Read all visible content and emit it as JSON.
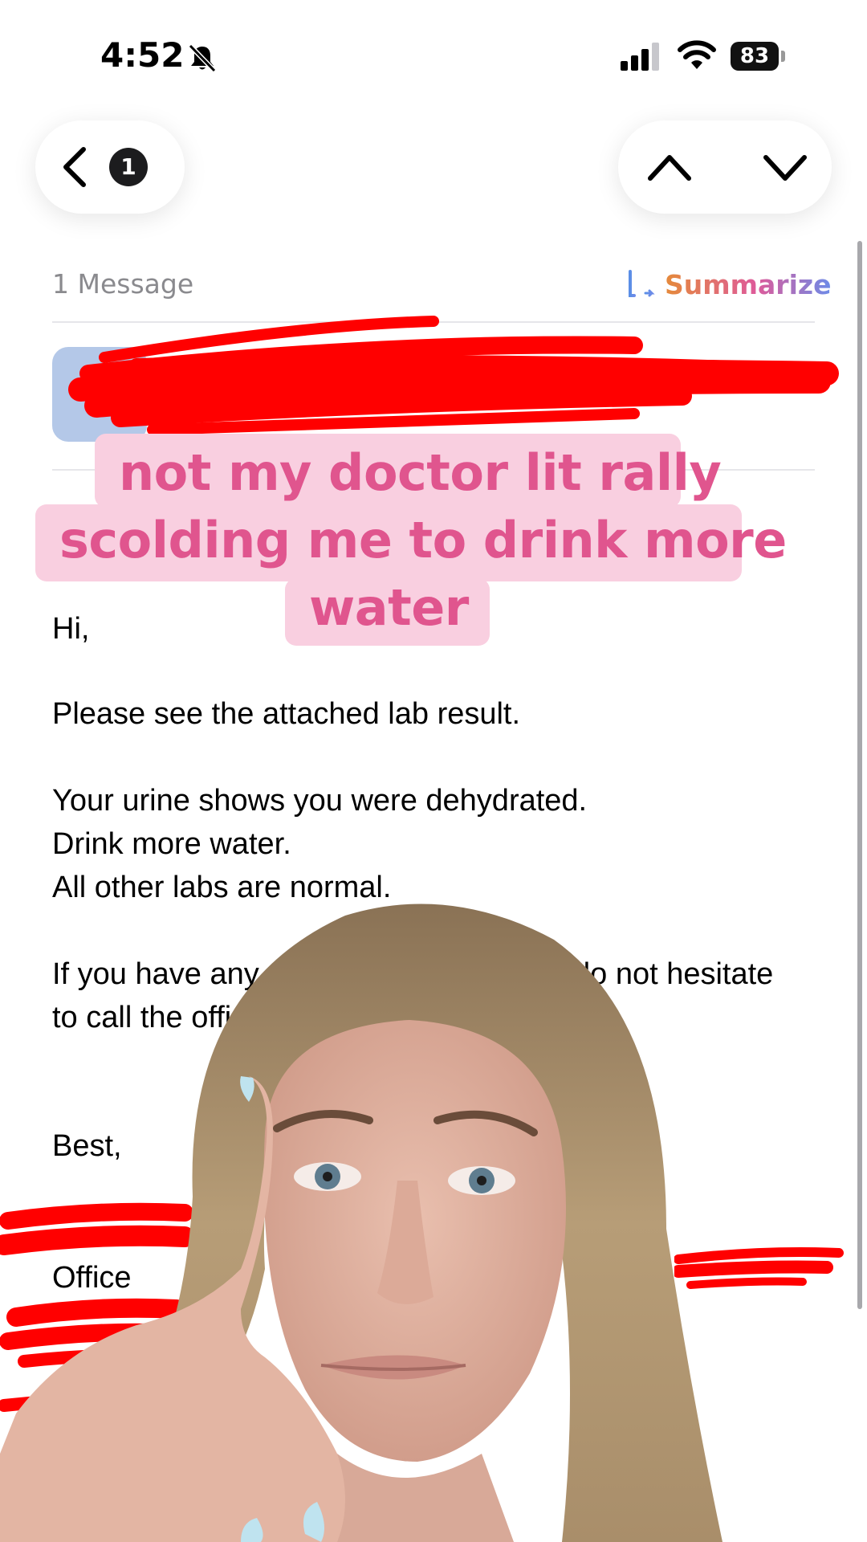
{
  "status_bar": {
    "time": "4:52",
    "silent_icon": "bell-slash-icon",
    "signal_icon": "cellular-signal-icon",
    "wifi_icon": "wifi-icon",
    "battery_level": "83"
  },
  "nav": {
    "back_icon": "chevron-left-icon",
    "unread_badge": "1",
    "prev_icon": "chevron-up-icon",
    "next_icon": "chevron-down-icon"
  },
  "thread": {
    "message_count": "1 Message",
    "summarize_label": "Summarize",
    "summarize_icon": "summarize-lines-icon",
    "summarize_colors": [
      "#e58a3a",
      "#de5b9a",
      "#6d8be8"
    ]
  },
  "overlay_caption": {
    "line1": "not my doctor lit rally",
    "line2": "scolding me to drink more",
    "line3": "water",
    "text_color": "#e0558e",
    "bg_color": "#f9cfe0"
  },
  "email_body": {
    "greeting": "Hi,",
    "line_attached": "Please see the attached lab result.",
    "line_dehydrated": "Your urine shows you were dehydrated.",
    "line_drink": "Drink more water.",
    "line_normal": "All other labs are normal.",
    "line_questions_start": "If you have any q",
    "line_questions_end": "do not hesitate",
    "line_call": "to call the offic",
    "signoff": "Best,",
    "sig_office": "Office"
  },
  "redaction_color": "#ff0000"
}
